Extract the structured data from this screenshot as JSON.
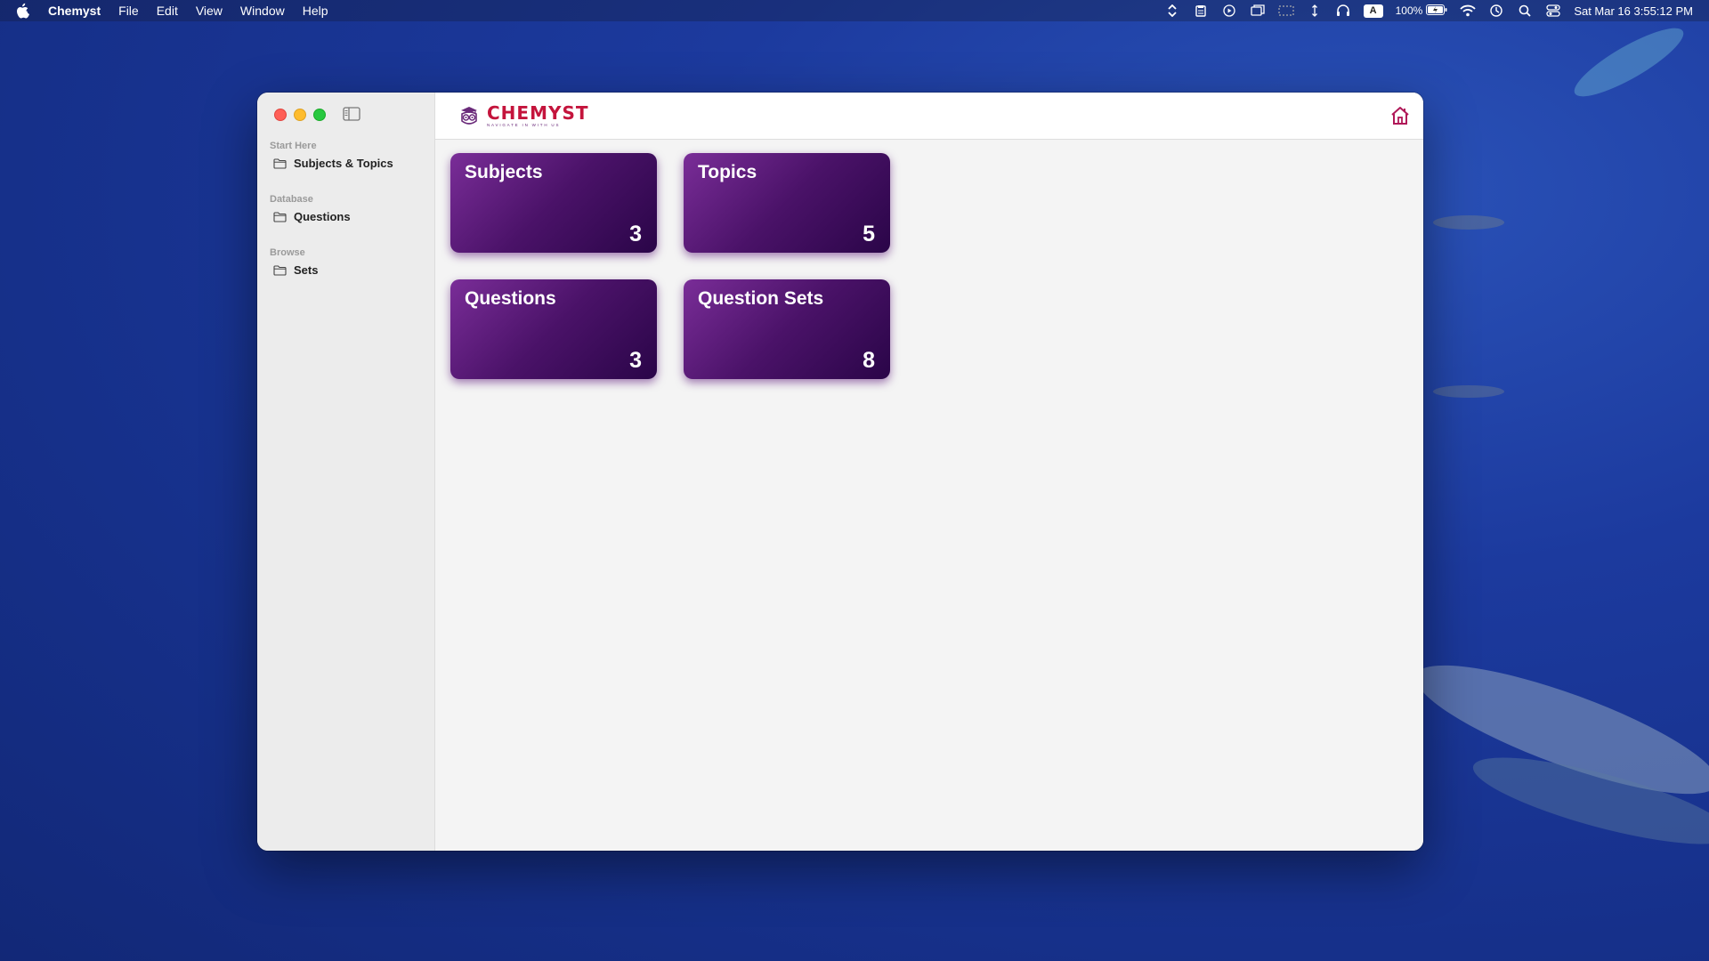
{
  "menubar": {
    "app_name": "Chemyst",
    "menus": [
      "File",
      "Edit",
      "View",
      "Window",
      "Help"
    ],
    "battery": "100%",
    "datetime": "Sat Mar 16  3:55:12 PM",
    "input_source": "A"
  },
  "app": {
    "logo_name": "CHEMYST",
    "logo_tagline": "NAVIGATE IN WITH US",
    "accent_color": "#c4143c",
    "card_color": "#4a1268"
  },
  "sidebar": {
    "sections": [
      {
        "heading": "Start Here",
        "item": "Subjects & Topics"
      },
      {
        "heading": "Database",
        "item": "Questions"
      },
      {
        "heading": "Browse",
        "item": "Sets"
      }
    ]
  },
  "cards": [
    {
      "title": "Subjects",
      "count": "3"
    },
    {
      "title": "Topics",
      "count": "5"
    },
    {
      "title": "Questions",
      "count": "3"
    },
    {
      "title": "Question Sets",
      "count": "8"
    }
  ]
}
